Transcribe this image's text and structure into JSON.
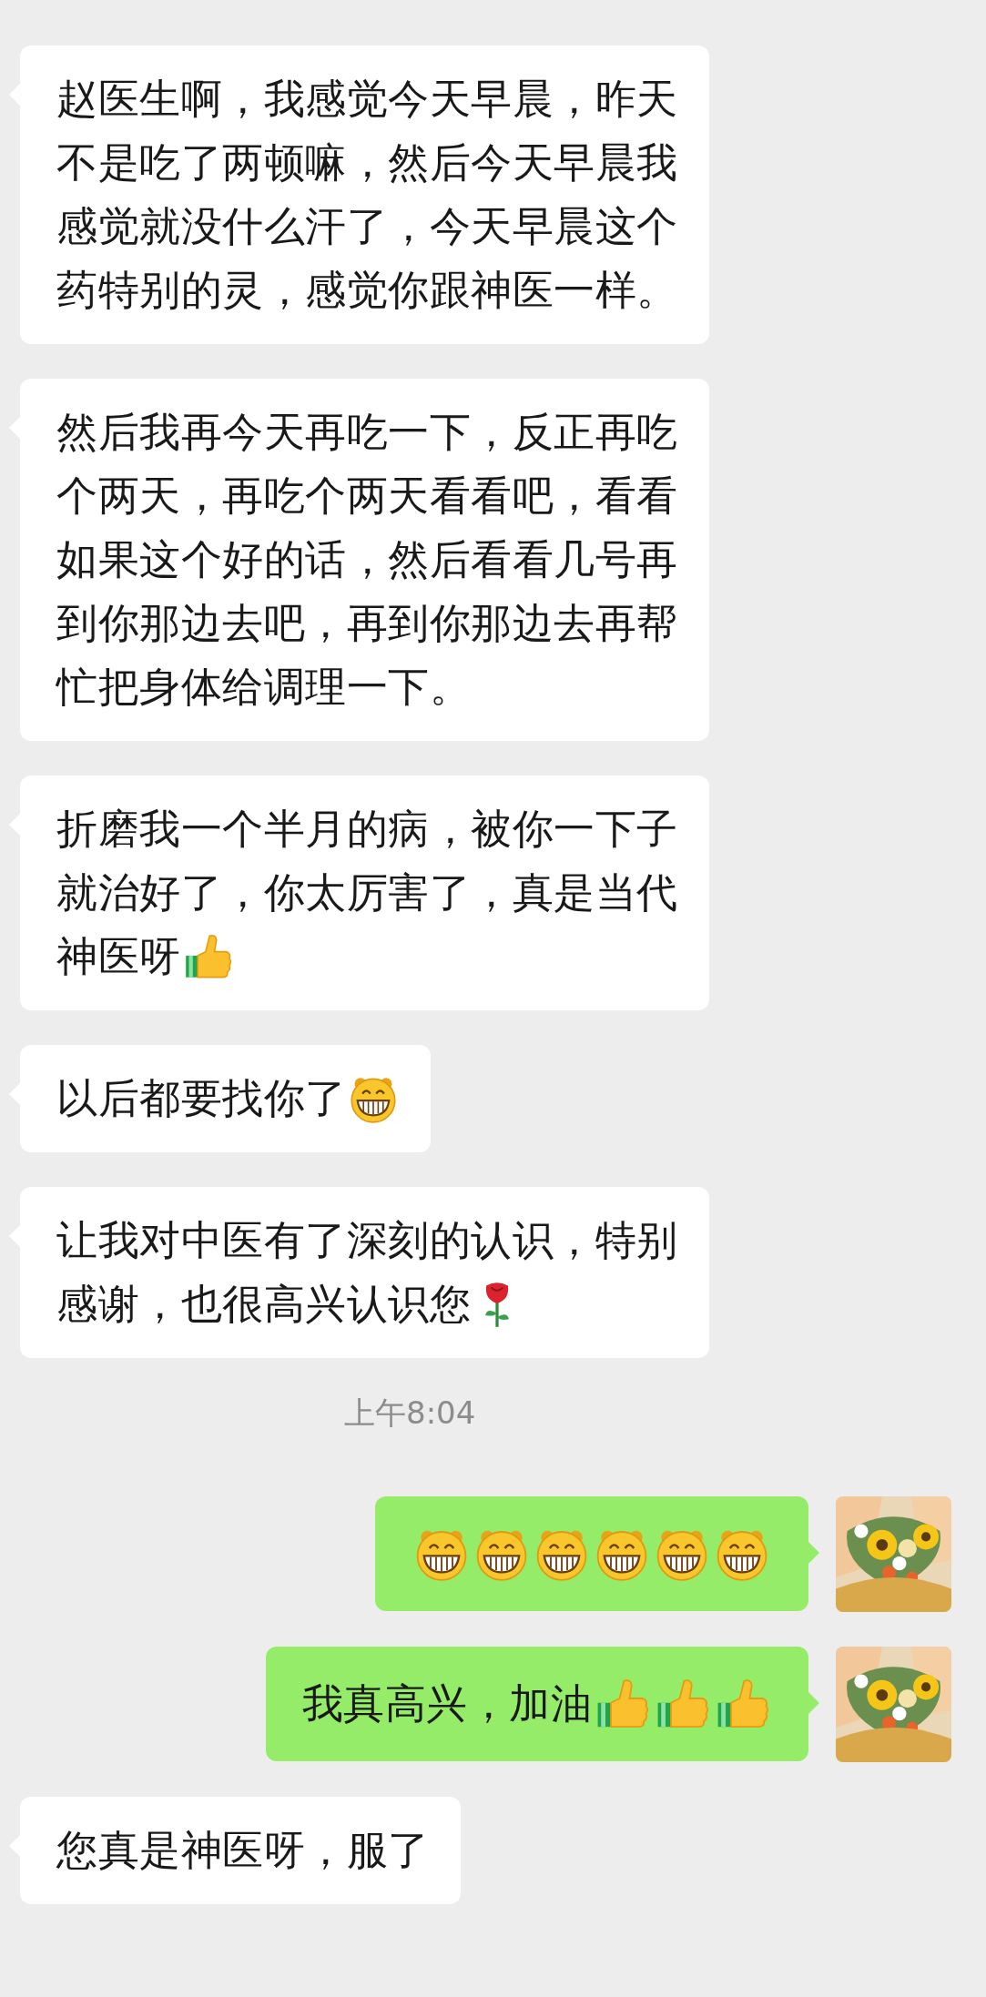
{
  "messages": [
    {
      "kind": "received",
      "lines": [
        [
          {
            "kind": "text",
            "text": "赵医生啊，我感觉今天早晨，昨天"
          }
        ],
        [
          {
            "kind": "text",
            "text": "不是吃了两顿嘛，然后今天早晨我"
          }
        ],
        [
          {
            "kind": "text",
            "text": "感觉就没什么汗了，今天早晨这个"
          }
        ],
        [
          {
            "kind": "text",
            "text": "药特别的灵，感觉你跟神医一样。"
          }
        ]
      ]
    },
    {
      "kind": "received",
      "lines": [
        [
          {
            "kind": "text",
            "text": "然后我再今天再吃一下，反正再吃"
          }
        ],
        [
          {
            "kind": "text",
            "text": "个两天，再吃个两天看看吧，看看"
          }
        ],
        [
          {
            "kind": "text",
            "text": "如果这个好的话，然后看看几号再"
          }
        ],
        [
          {
            "kind": "text",
            "text": "到你那边去吧，再到你那边去再帮"
          }
        ],
        [
          {
            "kind": "text",
            "text": "忙把身体给调理一下。"
          }
        ]
      ]
    },
    {
      "kind": "received",
      "lines": [
        [
          {
            "kind": "text",
            "text": "折磨我一个半月的病，被你一下子"
          }
        ],
        [
          {
            "kind": "text",
            "text": "就治好了，你太厉害了，真是当代"
          }
        ],
        [
          {
            "kind": "text",
            "text": "神医呀"
          },
          {
            "kind": "thumbs_up"
          }
        ]
      ]
    },
    {
      "kind": "received",
      "lines": [
        [
          {
            "kind": "text",
            "text": "以后都要找你了"
          },
          {
            "kind": "grin"
          }
        ]
      ]
    },
    {
      "kind": "received",
      "lines": [
        [
          {
            "kind": "text",
            "text": "让我对中医有了深刻的认识，特别"
          }
        ],
        [
          {
            "kind": "text",
            "text": "感谢，也很高兴认识您"
          },
          {
            "kind": "rose"
          }
        ]
      ]
    },
    {
      "kind": "time",
      "text": "上午8:04"
    },
    {
      "kind": "sent",
      "avatar": {
        "kind": "picture"
      },
      "lines": [
        [
          {
            "kind": "grin"
          },
          {
            "kind": "grin"
          },
          {
            "kind": "grin"
          },
          {
            "kind": "grin"
          },
          {
            "kind": "grin"
          },
          {
            "kind": "grin"
          }
        ]
      ]
    },
    {
      "kind": "sent",
      "avatar": {
        "kind": "picture"
      },
      "lines": [
        [
          {
            "kind": "text",
            "text": "我真高兴，加油"
          },
          {
            "kind": "thumbs_up"
          },
          {
            "kind": "thumbs_up"
          },
          {
            "kind": "thumbs_up"
          }
        ]
      ]
    },
    {
      "kind": "received",
      "lines": [
        [
          {
            "kind": "text",
            "text": "您真是神医呀，服了"
          }
        ]
      ]
    }
  ]
}
